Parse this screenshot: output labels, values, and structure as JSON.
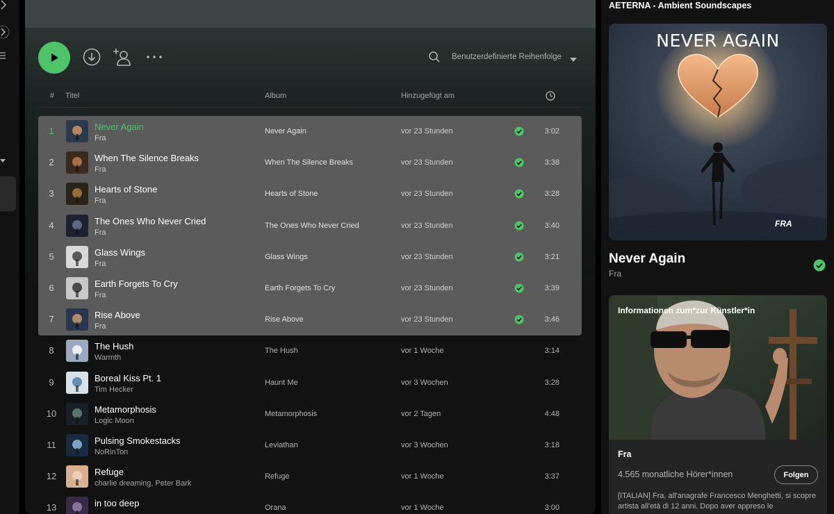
{
  "playlist_title": "AETERNA - Ambient Soundscapes",
  "sort": {
    "label": "Benutzerdefinierte Reihenfolge"
  },
  "columns": {
    "number": "#",
    "title": "Titel",
    "album": "Album",
    "added": "Hinzugefügt am"
  },
  "tracks": [
    {
      "num": "1",
      "title": "Never Again",
      "artist": "Fra",
      "album": "Never Again",
      "added": "vor 23 Stunden",
      "duration": "3:02"
    },
    {
      "num": "2",
      "title": "When The Silence Breaks",
      "artist": "Fra",
      "album": "When The Silence Breaks",
      "added": "vor 23 Stunden",
      "duration": "3:38"
    },
    {
      "num": "3",
      "title": "Hearts of Stone",
      "artist": "Fra",
      "album": "Hearts of Stone",
      "added": "vor 23 Stunden",
      "duration": "3:28"
    },
    {
      "num": "4",
      "title": "The Ones Who Never Cried",
      "artist": "Fra",
      "album": "The Ones Who Never Cried",
      "added": "vor 23 Stunden",
      "duration": "3:40"
    },
    {
      "num": "5",
      "title": "Glass Wings",
      "artist": "Fra",
      "album": "Glass Wings",
      "added": "vor 23 Stunden",
      "duration": "3:21"
    },
    {
      "num": "6",
      "title": "Earth Forgets To Cry",
      "artist": "Fra",
      "album": "Earth Forgets To Cry",
      "added": "vor 23 Stunden",
      "duration": "3:39"
    },
    {
      "num": "7",
      "title": "Rise Above",
      "artist": "Fra",
      "album": "Rise Above",
      "added": "vor 23 Stunden",
      "duration": "3:46"
    },
    {
      "num": "8",
      "title": "The Hush",
      "artist": "Warmth",
      "album": "The Hush",
      "added": "vor 1 Woche",
      "duration": "3:14"
    },
    {
      "num": "9",
      "title": "Boreal Kiss Pt. 1",
      "artist": "Tim Hecker",
      "album": "Haunt Me",
      "added": "vor 3 Wochen",
      "duration": "3:28"
    },
    {
      "num": "10",
      "title": "Metamorphosis",
      "artist": "Logic Moon",
      "album": "Metamorphosis",
      "added": "vor 2 Tagen",
      "duration": "4:48"
    },
    {
      "num": "11",
      "title": "Pulsing Smokestacks",
      "artist": "NoRinTon",
      "album": "Leviathan",
      "added": "vor 3 Wochen",
      "duration": "3:18"
    },
    {
      "num": "12",
      "title": "Refuge",
      "artist": "charlie dreaming, Peter Bark",
      "album": "Refuge",
      "added": "vor 1 Woche",
      "duration": "3:37"
    },
    {
      "num": "13",
      "title": "in too deep",
      "artist": "",
      "album": "Orana",
      "added": "vor 1 Woche",
      "duration": "3:00"
    }
  ],
  "now_playing": {
    "cover_title": "NEVER AGAIN",
    "cover_logo": "FRA",
    "title": "Never Again",
    "artist": "Fra"
  },
  "artist_card": {
    "label": "Informationen zum*zur Künstler*in",
    "name": "Fra",
    "listeners": "4.565 monatliche Hörer*innen",
    "follow_label": "Folgen",
    "bio": "[ITALIAN] Fra, all'anagrafe Francesco Menghetti, si scopre artista all'età di 12 anni. Dopo aver appreso le"
  },
  "colors": {
    "accent": "#4ec36a",
    "selection": "#5b5b5b",
    "panel": "#121212"
  },
  "icons": [
    "play-icon",
    "download-icon",
    "add-user-icon",
    "more-icon",
    "search-icon",
    "chevron-down-icon",
    "clock-icon",
    "check-circle-icon"
  ]
}
